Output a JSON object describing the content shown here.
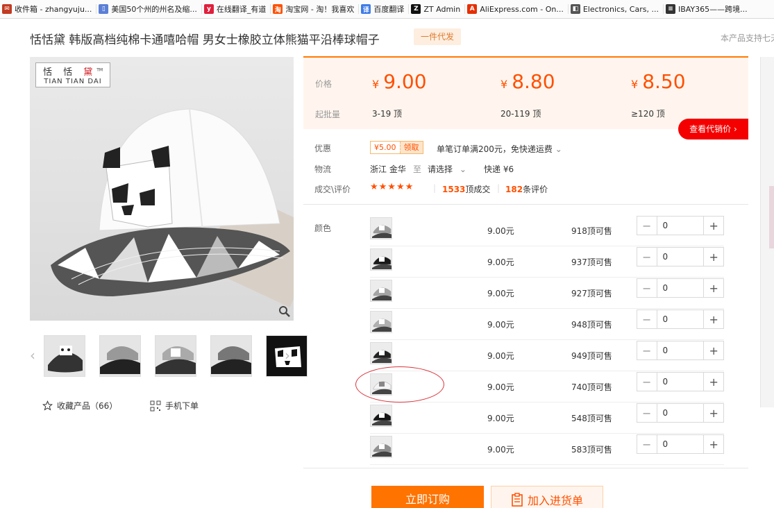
{
  "bookmarks": [
    {
      "label": "收件箱 - zhangyuju...",
      "icon": "mail-icon",
      "color": "#c23b22"
    },
    {
      "label": "美国50个州的州名及缩...",
      "icon": "page-icon",
      "color": "#5b7fd6"
    },
    {
      "label": "在线翻译_有道",
      "icon": "youdao-icon",
      "color": "#e0203c"
    },
    {
      "label": "淘宝网 - 淘！我喜欢",
      "icon": "taobao-icon",
      "color": "#ff5000"
    },
    {
      "label": "百度翻译",
      "icon": "baidu-icon",
      "color": "#3f7ce8"
    },
    {
      "label": "ZT Admin",
      "icon": "zt-icon",
      "color": "#111111"
    },
    {
      "label": "AliExpress.com - On...",
      "icon": "aliexpress-icon",
      "color": "#e62e04"
    },
    {
      "label": "Electronics, Cars, ...",
      "icon": "ebay-icon",
      "color": "#555555"
    },
    {
      "label": "IBAY365——跨境...",
      "icon": "ibay-icon",
      "color": "#333333"
    }
  ],
  "product": {
    "title": "恬恬黛 韩版高档纯棉卡通嘻哈帽 男女士橡胶立体熊猫平沿棒球帽子",
    "badge": "一件代发",
    "notice": "本产品支持七天"
  },
  "logo": {
    "cn_prefix": "恬 恬 ",
    "cn_red": "黛",
    "tm": "TM",
    "en": "TIAN TIAN DAI"
  },
  "price": {
    "label_price": "价格",
    "label_moq": "起批量",
    "currency": "¥",
    "tiers": [
      {
        "price": "9.00",
        "range": "3-19 顶"
      },
      {
        "price": "8.80",
        "range": "20-119 顶"
      },
      {
        "price": "8.50",
        "range": "≥120 顶"
      }
    ],
    "agent_button": "查看代销价"
  },
  "promo": {
    "label": "优惠",
    "coupon_amount": "¥5.00",
    "coupon_get": "领取",
    "text": "单笔订单满200元，免快递运费"
  },
  "logistics": {
    "label": "物流",
    "from": "浙江 金华",
    "to_word": "至",
    "select": "请选择",
    "shipping": "快递 ¥6"
  },
  "deals": {
    "label": "成交\\评价",
    "stars": "★★★★★",
    "deal_count": "1533",
    "deal_suffix": "顶成交",
    "review_count": "182",
    "review_suffix": "条评价"
  },
  "sku": {
    "label": "颜色",
    "rows": [
      {
        "price": "9.00元",
        "stock": "918",
        "stock_suffix": "顶可售",
        "qty": "0",
        "tone": "#9a9a9a"
      },
      {
        "price": "9.00元",
        "stock": "937",
        "stock_suffix": "顶可售",
        "qty": "0",
        "tone": "#1a1a1a"
      },
      {
        "price": "9.00元",
        "stock": "927",
        "stock_suffix": "顶可售",
        "qty": "0",
        "tone": "#a5a5a5"
      },
      {
        "price": "9.00元",
        "stock": "948",
        "stock_suffix": "顶可售",
        "qty": "0",
        "tone": "#b0b0b0"
      },
      {
        "price": "9.00元",
        "stock": "949",
        "stock_suffix": "顶可售",
        "qty": "0",
        "tone": "#222222"
      },
      {
        "price": "9.00元",
        "stock": "740",
        "stock_suffix": "顶可售",
        "qty": "0",
        "tone": "#f4f4f4"
      },
      {
        "price": "9.00元",
        "stock": "548",
        "stock_suffix": "顶可售",
        "qty": "0",
        "tone": "#151515"
      },
      {
        "price": "9.00元",
        "stock": "583",
        "stock_suffix": "顶可售",
        "qty": "0",
        "tone": "#8f8f8f"
      }
    ],
    "minus": "−",
    "plus": "+"
  },
  "gallery": {
    "favorite": "收藏产品（66）",
    "mobile": "手机下单",
    "prev": "‹",
    "next": "›"
  },
  "actions": {
    "buy_now": "立即订购",
    "add_cart": "加入进货单"
  }
}
